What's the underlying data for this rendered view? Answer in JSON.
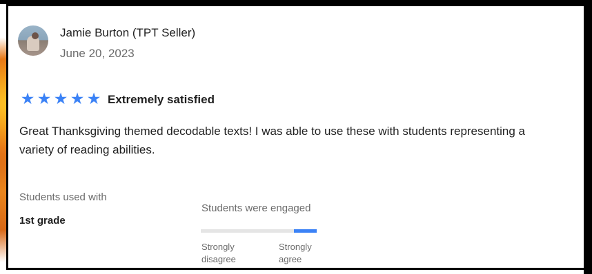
{
  "reviewer": {
    "name": "Jamie Burton (TPT Seller)",
    "date": "June 20, 2023"
  },
  "rating": {
    "stars": 5,
    "max_stars": 5,
    "label": "Extremely satisfied",
    "star_color": "#3b82f6"
  },
  "review": {
    "body": "Great Thanksgiving themed decodable texts!  I was able to use these with students representing a variety of reading abilities."
  },
  "students_used_with": {
    "label": "Students used with",
    "value": "1st grade"
  },
  "engagement": {
    "title": "Students were engaged",
    "level_fraction": 1.0,
    "low_label_line1": "Strongly",
    "low_label_line2": "disagree",
    "high_label_line1": "Strongly",
    "high_label_line2": "agree",
    "accent_color": "#3b82f6"
  },
  "icons": {
    "star": "star-icon",
    "avatar": "avatar"
  }
}
